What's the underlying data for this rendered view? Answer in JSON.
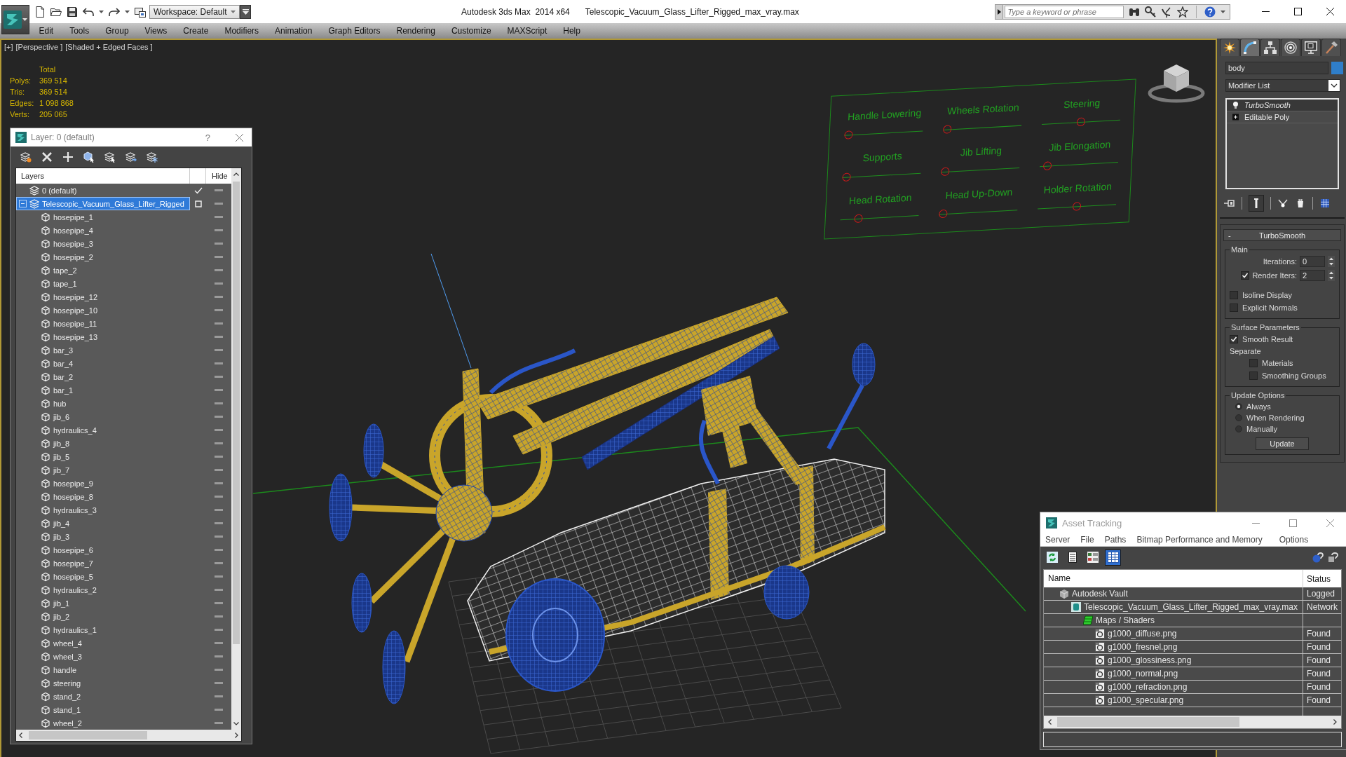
{
  "window": {
    "title": "Autodesk 3ds Max  2014 x64",
    "file_name": "Telescopic_Vacuum_Glass_Lifter_Rigged_max_vray.max"
  },
  "toolbar": {
    "workspace": "Workspace: Default"
  },
  "search": {
    "placeholder": "Type a keyword or phrase"
  },
  "menu": [
    "Edit",
    "Tools",
    "Group",
    "Views",
    "Create",
    "Modifiers",
    "Animation",
    "Graph Editors",
    "Rendering",
    "Customize",
    "MAXScript",
    "Help"
  ],
  "viewport": {
    "labels": [
      "[+]",
      "[Perspective ]",
      "[Shaded + Edged Faces ]"
    ],
    "stats_heading": "Total",
    "stats": [
      {
        "label": "Polys:",
        "value": "369 514"
      },
      {
        "label": "Tris:",
        "value": "369 514"
      },
      {
        "label": "Edges:",
        "value": "1 098 868"
      },
      {
        "label": "Verts:",
        "value": "205 065"
      }
    ],
    "rig_controls": [
      {
        "label": "Handle Lowering",
        "level": 0
      },
      {
        "label": "Wheels Rotation",
        "level": 0
      },
      {
        "label": "Steering",
        "level": 0.5
      },
      {
        "label": "Supports",
        "level": 0
      },
      {
        "label": "Jib Lifting",
        "level": 0
      },
      {
        "label": "Jib Elongation",
        "level": 0.05
      },
      {
        "label": "Head Rotation",
        "level": 0.2
      },
      {
        "label": "Head Up-Down",
        "level": 0
      },
      {
        "label": "Holder Rotation",
        "level": 0.5
      }
    ]
  },
  "layer_window": {
    "title": "Layer: 0 (default)",
    "help": "?",
    "columns": [
      "Layers",
      "Hide"
    ],
    "layers": [
      {
        "name": "0 (default)",
        "current": true,
        "selected": false
      },
      {
        "name": "Telescopic_Vacuum_Glass_Lifter_Rigged",
        "current": false,
        "selected": true,
        "expanded": true,
        "children": [
          {
            "name": "hosepipe_1",
            "selected": false
          },
          {
            "name": "hosepipe_4",
            "selected": false
          },
          {
            "name": "hosepipe_3",
            "selected": false
          },
          {
            "name": "hosepipe_2",
            "selected": false
          },
          {
            "name": "tape_2",
            "selected": false
          },
          {
            "name": "tape_1",
            "selected": false
          },
          {
            "name": "hosepipe_12",
            "selected": false
          },
          {
            "name": "hosepipe_10",
            "selected": false
          },
          {
            "name": "hosepipe_11",
            "selected": false
          },
          {
            "name": "hosepipe_13",
            "selected": false
          },
          {
            "name": "bar_3",
            "selected": false
          },
          {
            "name": "bar_4",
            "selected": false
          },
          {
            "name": "bar_2",
            "selected": false
          },
          {
            "name": "bar_1",
            "selected": false
          },
          {
            "name": "hub",
            "selected": false
          },
          {
            "name": "jib_6",
            "selected": false
          },
          {
            "name": "hydraulics_4",
            "selected": false
          },
          {
            "name": "jib_8",
            "selected": false
          },
          {
            "name": "jib_5",
            "selected": false
          },
          {
            "name": "jib_7",
            "selected": false
          },
          {
            "name": "hosepipe_9",
            "selected": false
          },
          {
            "name": "hosepipe_8",
            "selected": false
          },
          {
            "name": "hydraulics_3",
            "selected": false
          },
          {
            "name": "jib_4",
            "selected": false
          },
          {
            "name": "jib_3",
            "selected": false
          },
          {
            "name": "hosepipe_6",
            "selected": false
          },
          {
            "name": "hosepipe_7",
            "selected": false
          },
          {
            "name": "hosepipe_5",
            "selected": false
          },
          {
            "name": "hydraulics_2",
            "selected": false
          },
          {
            "name": "jib_1",
            "selected": false
          },
          {
            "name": "jib_2",
            "selected": false
          },
          {
            "name": "hydraulics_1",
            "selected": false
          },
          {
            "name": "wheel_4",
            "selected": false
          },
          {
            "name": "wheel_3",
            "selected": false
          },
          {
            "name": "handle",
            "selected": false
          },
          {
            "name": "steering",
            "selected": false
          },
          {
            "name": "stand_2",
            "selected": false
          },
          {
            "name": "stand_1",
            "selected": false
          },
          {
            "name": "wheel_2",
            "selected": false
          }
        ]
      }
    ]
  },
  "command_panel": {
    "tabs": [
      {
        "kind": "create",
        "selected": false
      },
      {
        "kind": "modify",
        "selected": true
      },
      {
        "kind": "hierarchy",
        "selected": false
      },
      {
        "kind": "motion",
        "selected": false
      },
      {
        "kind": "display",
        "selected": false
      },
      {
        "kind": "utilities",
        "selected": false
      }
    ],
    "object": {
      "name": "body",
      "color": "#2f7ec9"
    },
    "modifier_dropdown": "Modifier List",
    "stack": [
      {
        "name": "TurboSmooth",
        "kind": "modifier",
        "selected": true,
        "viewport_on": false
      },
      {
        "name": "Editable Poly",
        "kind": "base_object",
        "selected": false
      }
    ],
    "turbosmooth": {
      "collapse_sign": "-",
      "title": "TurboSmooth",
      "groups": [
        {
          "title": "Main",
          "controls": [
            {
              "kind": "spinner",
              "label": "Iterations:",
              "value": "0"
            },
            {
              "kind": "check_spinner",
              "label": "Render Iters:",
              "value": "2",
              "checked": true
            },
            {
              "kind": "checkbox",
              "label": "Isoline Display",
              "checked": false
            },
            {
              "kind": "checkbox",
              "label": "Explicit Normals",
              "checked": false
            }
          ]
        },
        {
          "title": "Surface Parameters",
          "controls": [
            {
              "kind": "checkbox",
              "label": "Smooth Result",
              "checked": true
            },
            {
              "kind": "heading",
              "label": "Separate",
              "children": [
                {
                  "kind": "checkbox",
                  "label": "Materials",
                  "checked": false
                },
                {
                  "kind": "checkbox",
                  "label": "Smoothing Groups",
                  "checked": false
                }
              ]
            }
          ]
        },
        {
          "title": "Update Options",
          "controls": [
            {
              "kind": "radio",
              "label": "Always",
              "selected": true
            },
            {
              "kind": "radio",
              "label": "When Rendering",
              "selected": false
            },
            {
              "kind": "radio",
              "label": "Manually",
              "selected": false
            },
            {
              "kind": "button",
              "label": "Update"
            }
          ]
        }
      ]
    }
  },
  "asset_tracking": {
    "title": "Asset Tracking",
    "menu": [
      "Server",
      "File",
      "Paths",
      "Bitmap Performance and Memory",
      "Options"
    ],
    "toolbar": [
      {
        "kind": "refresh",
        "selected": false
      },
      {
        "kind": "list",
        "selected": false
      },
      {
        "kind": "thumbnails",
        "selected": false
      },
      {
        "kind": "table",
        "selected": true
      }
    ],
    "columns": [
      "Name",
      "Status"
    ],
    "tree": [
      {
        "kind": "vault",
        "name": "Autodesk Vault",
        "status": "Logged",
        "children": [
          {
            "kind": "scene",
            "name": "Telescopic_Vacuum_Glass_Lifter_Rigged_max_vray.max",
            "status": "Network",
            "children": [
              {
                "kind": "maps",
                "name": "Maps / Shaders",
                "children": [
                  {
                    "kind": "bitmap",
                    "name": "g1000_diffuse.png",
                    "status": "Found"
                  },
                  {
                    "kind": "bitmap",
                    "name": "g1000_fresnel.png",
                    "status": "Found"
                  },
                  {
                    "kind": "bitmap",
                    "name": "g1000_glossiness.png",
                    "status": "Found"
                  },
                  {
                    "kind": "bitmap",
                    "name": "g1000_normal.png",
                    "status": "Found"
                  },
                  {
                    "kind": "bitmap",
                    "name": "g1000_refraction.png",
                    "status": "Found"
                  },
                  {
                    "kind": "bitmap",
                    "name": "g1000_specular.png",
                    "status": "Found"
                  }
                ]
              }
            ]
          }
        ]
      }
    ]
  }
}
